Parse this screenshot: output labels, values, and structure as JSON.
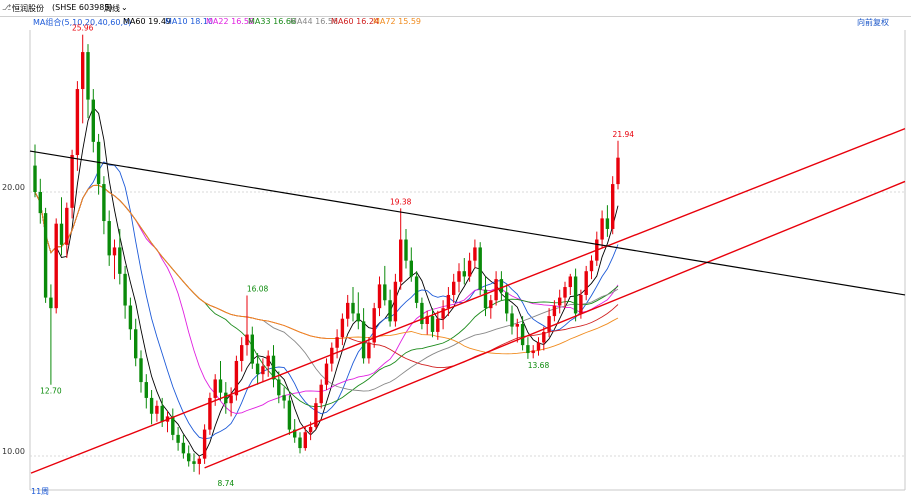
{
  "header": {
    "stock_label": "恒润股份",
    "exchange_code": "(SHSE 603985)",
    "period_label": "周线",
    "ma_group_label": "MA组合(5,10,20,40,60,0)",
    "corner_button": "向前复权"
  },
  "ma_legend": [
    {
      "label": "MA60 19.49",
      "color": "#000000"
    },
    {
      "label": "MA10 18.10",
      "color": "#1e5bd8"
    },
    {
      "label": "MA22 16.58",
      "color": "#e020e0"
    },
    {
      "label": "MA33 16.66",
      "color": "#1a8a1a"
    },
    {
      "label": "MA44 16.56",
      "color": "#888888"
    },
    {
      "label": "MA60 16.24",
      "color": "#d02020"
    },
    {
      "label": "MA72 15.59",
      "color": "#f08c20"
    }
  ],
  "colors": {
    "up": "#e8000b",
    "down": "#0a8a0a",
    "trend": "#e8000b",
    "resist": "#000000"
  },
  "chart_data": {
    "type": "candlestick",
    "y_ticks": [
      "20.00",
      "10.00"
    ],
    "ylim": [
      10.0,
      26.5
    ],
    "bottom_label": "11周",
    "annotations": [
      {
        "text": "25.96",
        "x": 9,
        "y": 25.96,
        "color": "#e8000b",
        "pos": "above"
      },
      {
        "text": "12.70",
        "x": 3,
        "y": 12.7,
        "color": "#0a8a0a",
        "pos": "below"
      },
      {
        "text": "16.08",
        "x": 42,
        "y": 16.08,
        "color": "#0a8a0a",
        "pos": "above"
      },
      {
        "text": "8.74",
        "x": 36,
        "y": 9.2,
        "color": "#0a8a0a",
        "pos": "below"
      },
      {
        "text": "19.38",
        "x": 69,
        "y": 19.38,
        "color": "#e8000b",
        "pos": "above"
      },
      {
        "text": "13.68",
        "x": 95,
        "y": 13.68,
        "color": "#0a8a0a",
        "pos": "below"
      },
      {
        "text": "21.94",
        "x": 111,
        "y": 21.94,
        "color": "#e8000b",
        "pos": "above"
      }
    ],
    "ohlc": [
      [
        21.0,
        21.8,
        19.8,
        20.0
      ],
      [
        20.0,
        20.5,
        18.8,
        19.2
      ],
      [
        19.2,
        19.4,
        15.8,
        16.0
      ],
      [
        16.0,
        16.5,
        12.7,
        15.6
      ],
      [
        15.6,
        19.0,
        15.4,
        18.8
      ],
      [
        18.8,
        19.8,
        17.6,
        18.0
      ],
      [
        18.0,
        19.6,
        17.5,
        19.4
      ],
      [
        19.4,
        21.6,
        19.0,
        21.4
      ],
      [
        21.4,
        24.2,
        20.8,
        23.9
      ],
      [
        23.9,
        25.96,
        22.6,
        25.3
      ],
      [
        25.3,
        25.6,
        22.8,
        23.5
      ],
      [
        23.5,
        23.9,
        21.5,
        21.9
      ],
      [
        21.9,
        22.2,
        19.9,
        20.3
      ],
      [
        20.3,
        20.6,
        18.4,
        18.9
      ],
      [
        18.9,
        19.3,
        17.2,
        17.6
      ],
      [
        17.6,
        18.2,
        16.7,
        17.9
      ],
      [
        17.9,
        18.6,
        16.5,
        16.9
      ],
      [
        16.9,
        17.2,
        15.2,
        15.7
      ],
      [
        15.7,
        16.0,
        14.4,
        14.8
      ],
      [
        14.8,
        15.2,
        13.4,
        13.7
      ],
      [
        13.7,
        14.0,
        12.4,
        12.8
      ],
      [
        12.8,
        13.1,
        11.8,
        12.2
      ],
      [
        12.2,
        12.5,
        11.2,
        11.6
      ],
      [
        11.6,
        12.1,
        11.3,
        11.9
      ],
      [
        11.9,
        12.2,
        11.1,
        11.3
      ],
      [
        11.3,
        11.7,
        10.9,
        11.5
      ],
      [
        11.5,
        11.8,
        10.6,
        10.8
      ],
      [
        10.8,
        11.1,
        10.2,
        10.5
      ],
      [
        10.5,
        10.8,
        9.9,
        10.1
      ],
      [
        10.1,
        10.4,
        9.6,
        9.8
      ],
      [
        9.8,
        10.1,
        9.4,
        9.7
      ],
      [
        9.7,
        10.0,
        9.3,
        9.9
      ],
      [
        9.9,
        11.2,
        9.7,
        11.0
      ],
      [
        11.0,
        12.4,
        10.8,
        12.2
      ],
      [
        12.2,
        13.1,
        11.9,
        12.9
      ],
      [
        12.9,
        13.6,
        12.1,
        12.4
      ],
      [
        12.4,
        12.8,
        11.6,
        12.0
      ],
      [
        12.0,
        12.6,
        11.5,
        12.3
      ],
      [
        12.3,
        13.8,
        12.1,
        13.6
      ],
      [
        13.6,
        14.5,
        13.2,
        14.2
      ],
      [
        14.2,
        16.08,
        13.8,
        14.6
      ],
      [
        14.6,
        14.9,
        13.3,
        13.5
      ],
      [
        13.5,
        13.9,
        12.7,
        13.1
      ],
      [
        13.1,
        13.7,
        12.8,
        13.4
      ],
      [
        13.4,
        14.0,
        13.0,
        13.8
      ],
      [
        13.8,
        14.2,
        12.6,
        12.9
      ],
      [
        12.9,
        13.2,
        12.0,
        12.3
      ],
      [
        12.3,
        12.6,
        11.8,
        12.1
      ],
      [
        12.1,
        12.3,
        10.8,
        11.0
      ],
      [
        11.0,
        11.4,
        10.5,
        10.7
      ],
      [
        10.7,
        10.9,
        10.1,
        10.3
      ],
      [
        10.3,
        11.1,
        10.2,
        10.9
      ],
      [
        10.9,
        11.3,
        10.6,
        11.1
      ],
      [
        11.1,
        12.2,
        11.0,
        12.0
      ],
      [
        12.0,
        12.9,
        11.8,
        12.7
      ],
      [
        12.7,
        13.7,
        12.5,
        13.5
      ],
      [
        13.5,
        14.3,
        13.2,
        14.1
      ],
      [
        14.1,
        14.8,
        13.7,
        14.5
      ],
      [
        14.5,
        15.4,
        14.2,
        15.2
      ],
      [
        15.2,
        16.1,
        14.9,
        15.8
      ],
      [
        15.8,
        16.4,
        15.1,
        15.4
      ],
      [
        15.4,
        16.2,
        14.8,
        15.1
      ],
      [
        15.1,
        15.6,
        13.5,
        13.7
      ],
      [
        13.7,
        14.5,
        13.5,
        14.3
      ],
      [
        14.3,
        15.8,
        14.1,
        15.6
      ],
      [
        15.6,
        16.8,
        15.3,
        16.5
      ],
      [
        16.5,
        17.2,
        15.7,
        15.9
      ],
      [
        15.9,
        16.3,
        14.9,
        15.1
      ],
      [
        15.1,
        16.9,
        14.9,
        16.6
      ],
      [
        16.6,
        19.38,
        16.3,
        18.2
      ],
      [
        18.2,
        18.6,
        17.1,
        17.4
      ],
      [
        17.4,
        17.9,
        16.6,
        16.8
      ],
      [
        16.8,
        17.0,
        15.6,
        15.8
      ],
      [
        15.8,
        16.0,
        14.8,
        15.0
      ],
      [
        15.0,
        15.5,
        14.6,
        15.3
      ],
      [
        15.3,
        15.6,
        14.5,
        14.7
      ],
      [
        14.7,
        15.5,
        14.4,
        15.2
      ],
      [
        15.2,
        15.9,
        14.8,
        15.6
      ],
      [
        15.6,
        16.4,
        15.3,
        16.1
      ],
      [
        16.1,
        16.9,
        15.8,
        16.6
      ],
      [
        16.6,
        17.3,
        16.2,
        17.0
      ],
      [
        17.0,
        17.5,
        16.5,
        16.8
      ],
      [
        16.8,
        17.7,
        16.6,
        17.4
      ],
      [
        17.4,
        18.2,
        17.1,
        17.9
      ],
      [
        17.9,
        18.1,
        16.1,
        16.3
      ],
      [
        16.3,
        16.8,
        15.3,
        15.6
      ],
      [
        15.6,
        16.1,
        15.2,
        15.9
      ],
      [
        15.9,
        17.0,
        15.7,
        16.7
      ],
      [
        16.7,
        17.0,
        15.9,
        16.2
      ],
      [
        16.2,
        16.5,
        15.1,
        15.4
      ],
      [
        15.4,
        15.7,
        14.6,
        14.9
      ],
      [
        14.9,
        15.2,
        14.3,
        15.0
      ],
      [
        15.0,
        15.3,
        14.0,
        14.2
      ],
      [
        14.2,
        14.5,
        13.68,
        13.9
      ],
      [
        13.9,
        14.2,
        13.7,
        14.0
      ],
      [
        14.0,
        14.5,
        13.8,
        14.3
      ],
      [
        14.3,
        14.9,
        14.0,
        14.7
      ],
      [
        14.7,
        15.6,
        14.5,
        15.3
      ],
      [
        15.3,
        15.9,
        15.1,
        15.7
      ],
      [
        15.7,
        16.3,
        15.4,
        16.0
      ],
      [
        16.0,
        16.6,
        15.6,
        16.4
      ],
      [
        16.4,
        16.9,
        16.1,
        16.8
      ],
      [
        16.8,
        17.1,
        15.1,
        15.4
      ],
      [
        15.4,
        16.3,
        15.2,
        16.1
      ],
      [
        16.1,
        17.2,
        15.9,
        17.0
      ],
      [
        17.0,
        17.6,
        16.7,
        17.4
      ],
      [
        17.4,
        18.5,
        17.2,
        18.2
      ],
      [
        18.2,
        19.3,
        17.9,
        19.0
      ],
      [
        19.0,
        19.5,
        18.3,
        18.6
      ],
      [
        18.6,
        20.6,
        18.4,
        20.3
      ],
      [
        20.3,
        21.94,
        20.1,
        21.3
      ]
    ]
  }
}
